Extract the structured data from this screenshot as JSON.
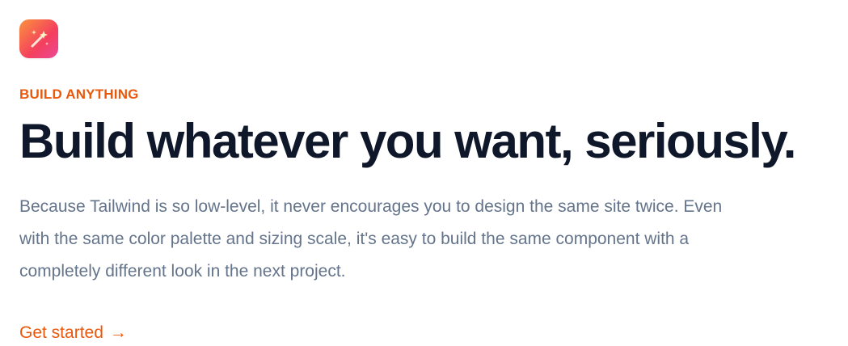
{
  "colors": {
    "accent": "#ea580c",
    "headline": "#0f172a",
    "body": "#64748b"
  },
  "feature": {
    "icon": "magic-wand-icon",
    "eyebrow": "Build anything",
    "headline": "Build whatever you want, seriously.",
    "description": "Because Tailwind is so low-level, it never encourages you to design the same site twice. Even with the same color palette and sizing scale, it's easy to build the same component with a completely different look in the next project.",
    "cta_label": "Get started",
    "cta_arrow": "→"
  }
}
